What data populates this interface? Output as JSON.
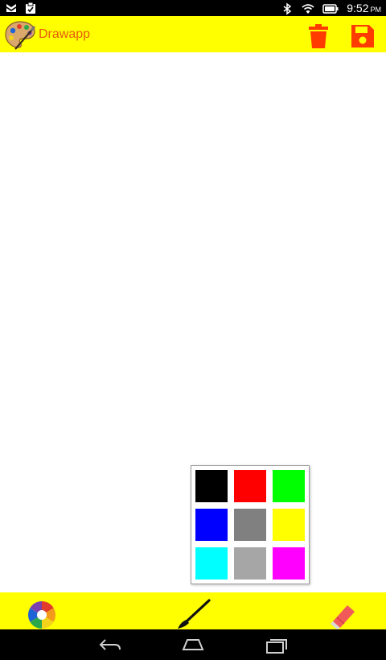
{
  "status_bar": {
    "time": "9:52",
    "ampm": "PM",
    "icons": [
      "notification-icon",
      "clipboard-icon",
      "bluetooth-icon",
      "wifi-icon",
      "battery-icon"
    ]
  },
  "app_bar": {
    "title": "Drawapp",
    "logo_icon": "palette-logo-icon",
    "actions": [
      "trash-icon",
      "save-icon"
    ],
    "title_color": "#e85a0c",
    "background": "#ffff00",
    "action_color": "#ff3b00"
  },
  "palette": {
    "swatches": [
      "#000000",
      "#ff0000",
      "#00ff00",
      "#0000ff",
      "#808080",
      "#ffff00",
      "#00ffff",
      "#a6a6a6",
      "#ff00ff"
    ]
  },
  "toolbar": {
    "background": "#ffff00",
    "tools": [
      "color-wheel-icon",
      "brush-icon",
      "eraser-icon"
    ]
  },
  "nav_bar": {
    "buttons": [
      "back-icon",
      "home-icon",
      "recents-icon"
    ]
  }
}
